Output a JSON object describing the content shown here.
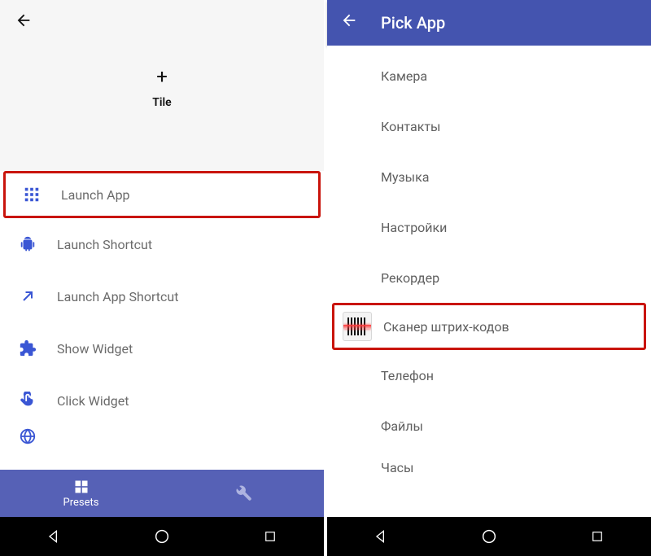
{
  "left": {
    "tile_label": "Tile",
    "actions": [
      {
        "key": "launch-app",
        "label": "Launch App",
        "highlight": true
      },
      {
        "key": "launch-shortcut",
        "label": "Launch Shortcut",
        "highlight": false
      },
      {
        "key": "launch-app-shortcut",
        "label": "Launch App Shortcut",
        "highlight": false
      },
      {
        "key": "show-widget",
        "label": "Show Widget",
        "highlight": false
      },
      {
        "key": "click-widget",
        "label": "Click Widget",
        "highlight": false
      }
    ],
    "bottom": {
      "presets": "Presets"
    }
  },
  "right": {
    "title": "Pick App",
    "apps": [
      {
        "key": "camera",
        "label": "Камера",
        "highlight": false,
        "icon": false
      },
      {
        "key": "contacts",
        "label": "Контакты",
        "highlight": false,
        "icon": false
      },
      {
        "key": "music",
        "label": "Музыка",
        "highlight": false,
        "icon": false
      },
      {
        "key": "settings",
        "label": "Настройки",
        "highlight": false,
        "icon": false
      },
      {
        "key": "recorder",
        "label": "Рекордер",
        "highlight": false,
        "icon": false
      },
      {
        "key": "barcode",
        "label": "Сканер штрих-кодов",
        "highlight": true,
        "icon": true
      },
      {
        "key": "phone",
        "label": "Телефон",
        "highlight": false,
        "icon": false
      },
      {
        "key": "files",
        "label": "Файлы",
        "highlight": false,
        "icon": false
      },
      {
        "key": "clock",
        "label": "Часы",
        "highlight": false,
        "icon": false
      }
    ]
  }
}
